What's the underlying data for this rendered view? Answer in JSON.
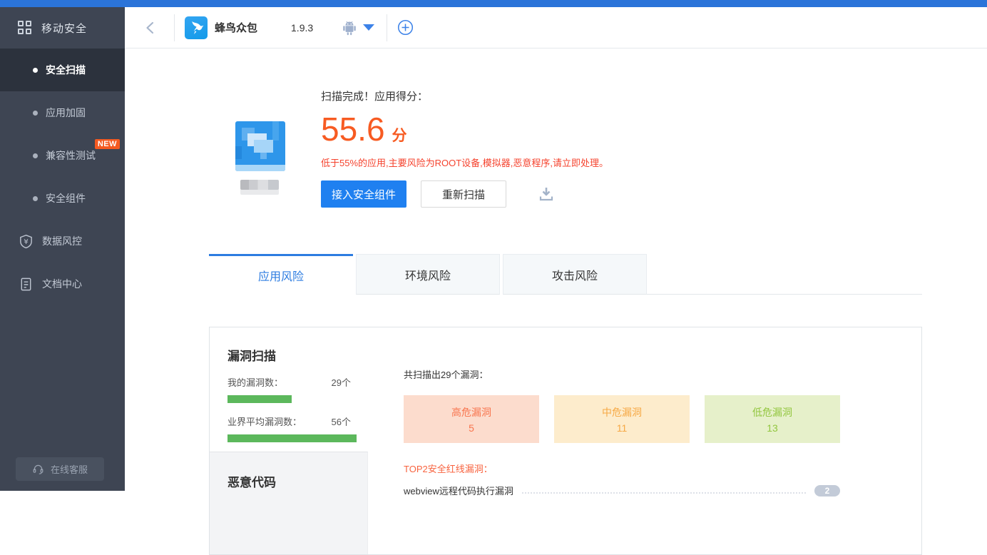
{
  "colors": {
    "topbar": "#2b74d9",
    "accent": "#2d7ce0",
    "primary_button": "#1f80f0",
    "score_orange": "#f75b22",
    "warning_red": "#f5432e",
    "bar_green": "#5cb85c",
    "new_badge": "#f55a21"
  },
  "sidebar": {
    "brand": "移动安全",
    "items": [
      {
        "label": "安全扫描",
        "active": true
      },
      {
        "label": "应用加固"
      },
      {
        "label": "兼容性测试",
        "badge": "NEW"
      },
      {
        "label": "安全组件"
      },
      {
        "label": "数据风控",
        "icon": "shield-yuan-icon"
      },
      {
        "label": "文档中心",
        "icon": "document-icon"
      }
    ],
    "support": "在线客服"
  },
  "header": {
    "app_name": "蜂鸟众包",
    "version": "1.9.3",
    "platform": "android"
  },
  "score": {
    "title": "扫描完成！应用得分：",
    "value": "55.6",
    "unit": "分",
    "warning": "低于55%的应用,主要风险为ROOT设备,模拟器,恶意程序,请立即处理。",
    "primary_button": "接入安全组件",
    "secondary_button": "重新扫描"
  },
  "tabs": [
    {
      "label": "应用风险",
      "active": true
    },
    {
      "label": "环境风险",
      "active": false
    },
    {
      "label": "攻击风险",
      "active": false
    }
  ],
  "vuln_panel": {
    "sections": [
      {
        "label": "漏洞扫描",
        "active": true
      },
      {
        "label": "恶意代码",
        "active": false
      }
    ],
    "my_vuln_label": "我的漏洞数：",
    "my_vuln_value": "29个",
    "industry_label": "业界平均漏洞数：",
    "industry_value": "56个",
    "bar_values": {
      "mine": 29,
      "industry": 56
    },
    "summary": "共扫描出29个漏洞：",
    "severity_boxes": [
      {
        "label": "高危漏洞",
        "count": "5",
        "bg": "#fcdccd",
        "color": "#f8754e"
      },
      {
        "label": "中危漏洞",
        "count": "11",
        "bg": "#fdeccc",
        "color": "#f6a844"
      },
      {
        "label": "低危漏洞",
        "count": "13",
        "bg": "#e6f0ca",
        "color": "#92c63e"
      }
    ],
    "top_title": "TOP2安全红线漏洞：",
    "top_items": [
      {
        "label": "webview远程代码执行漏洞",
        "count": "2"
      }
    ]
  }
}
